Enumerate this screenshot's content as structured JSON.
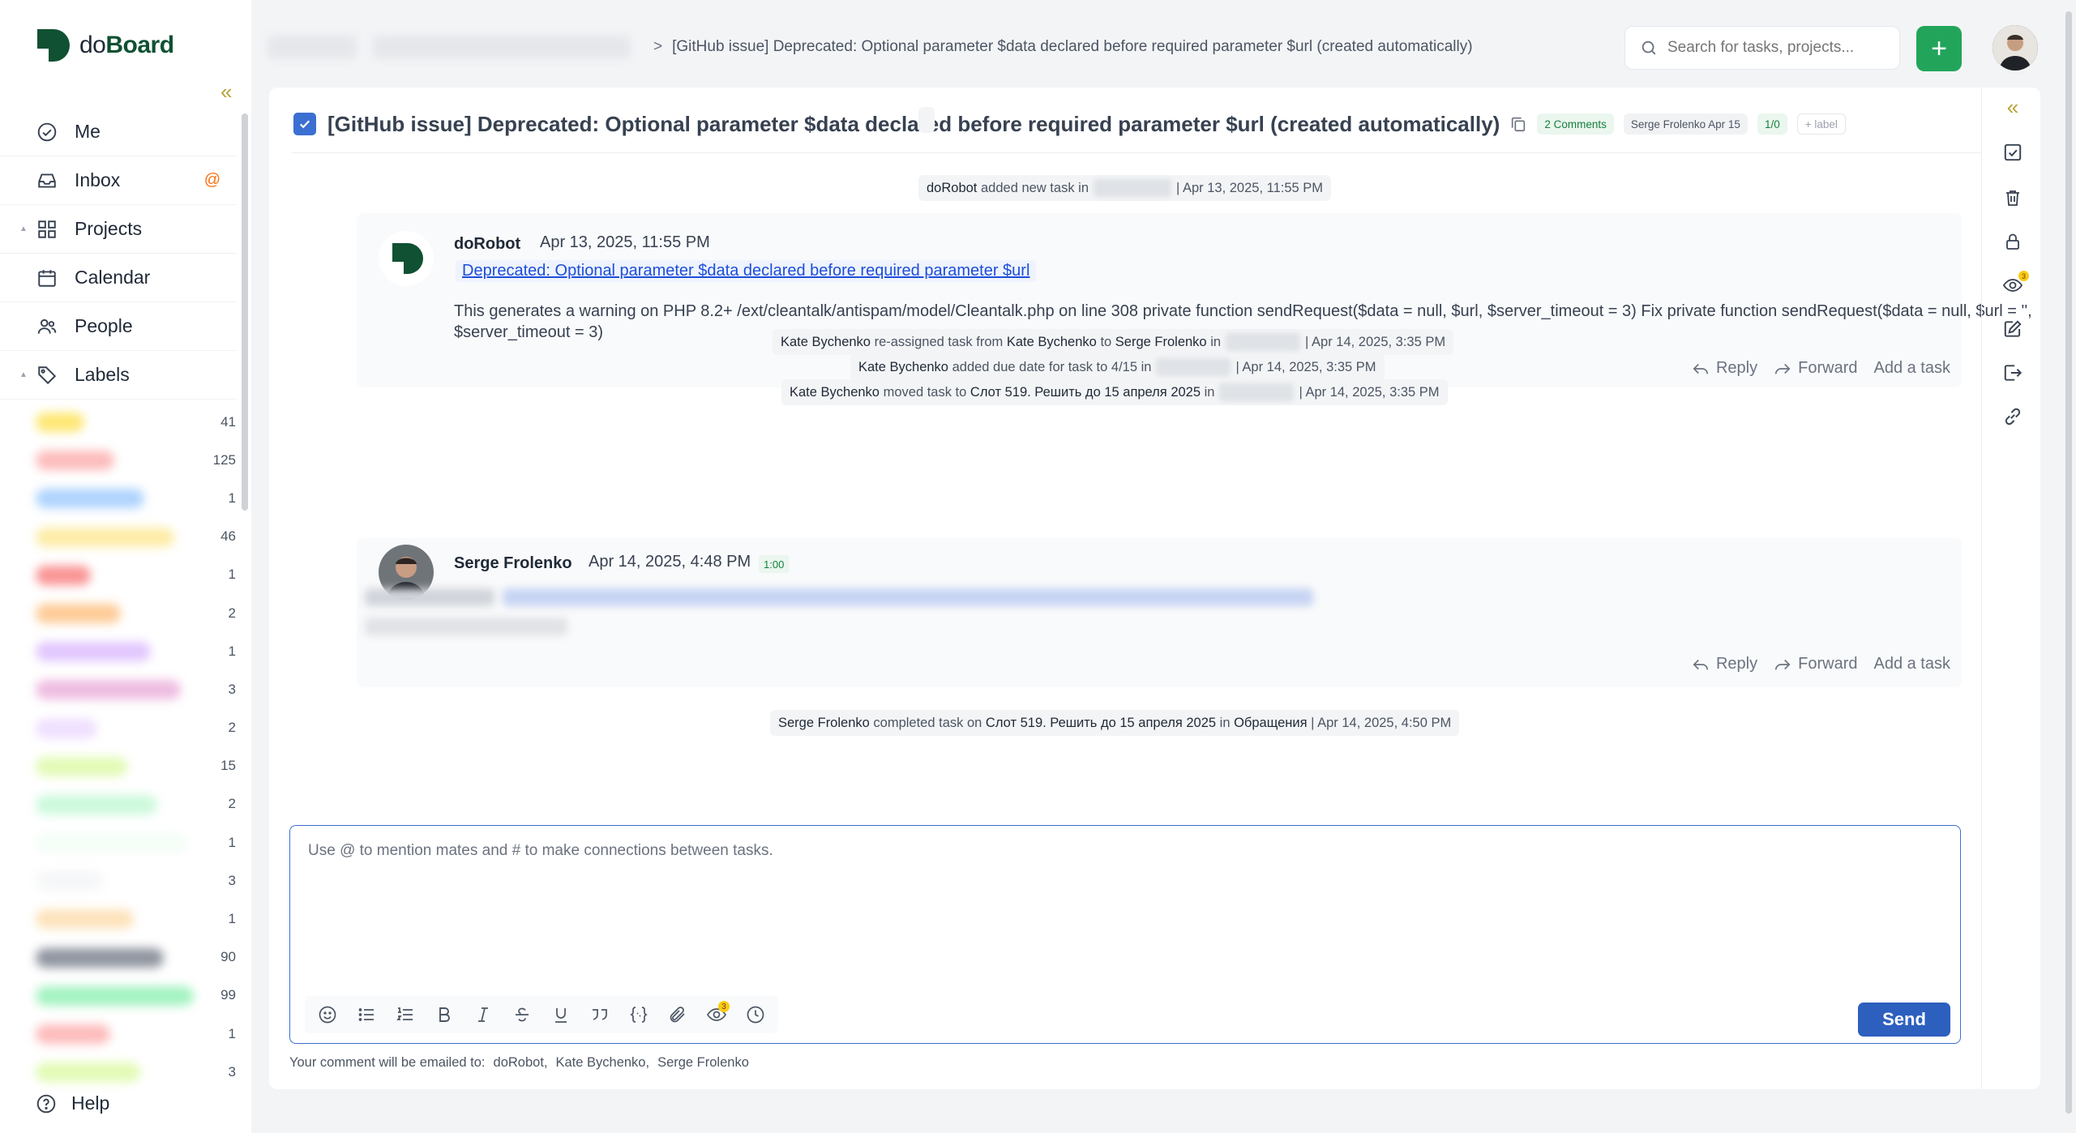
{
  "app": {
    "logo_text_do": "do",
    "logo_text_board": "Board"
  },
  "sidebar": {
    "collapse_icon": "double-chevron-left",
    "items": [
      {
        "label": "Me",
        "icon": "check-circle-icon"
      },
      {
        "label": "Inbox",
        "icon": "inbox-icon",
        "badge": "@"
      },
      {
        "label": "Projects",
        "icon": "grid-icon"
      },
      {
        "label": "Calendar",
        "icon": "calendar-icon"
      },
      {
        "label": "People",
        "icon": "people-icon"
      },
      {
        "label": "Labels",
        "icon": "tag-icon"
      }
    ],
    "labels": [
      {
        "count": "41",
        "color": "#fde047"
      },
      {
        "count": "125",
        "color": "#fca5a5"
      },
      {
        "count": "1",
        "color": "#93c5fd"
      },
      {
        "count": "46",
        "color": "#fde68a"
      },
      {
        "count": "1",
        "color": "#f87171"
      },
      {
        "count": "2",
        "color": "#fdba74"
      },
      {
        "count": "1",
        "color": "#d8b4fe"
      },
      {
        "count": "3",
        "color": "#e9a6d8"
      },
      {
        "count": "2",
        "color": "#e9d5ff"
      },
      {
        "count": "15",
        "color": "#d9f99d"
      },
      {
        "count": "2",
        "color": "#bbf7d0"
      },
      {
        "count": "1",
        "color": "#f0fdf4"
      },
      {
        "count": "3",
        "color": "#f3f4f6"
      },
      {
        "count": "1",
        "color": "#fcd9a5"
      },
      {
        "count": "90",
        "color": "#6b7280"
      },
      {
        "count": "99",
        "color": "#86efac"
      },
      {
        "count": "1",
        "color": "#fca5a5"
      },
      {
        "count": "3",
        "color": "#d9f99d"
      }
    ],
    "help_label": "Help"
  },
  "header": {
    "breadcrumb_separator": ">",
    "title": "[GitHub issue] Deprecated: Optional parameter $data declared before required parameter $url (created automatically)",
    "search_placeholder": "Search for tasks, projects...",
    "add_label": "+"
  },
  "task": {
    "title": "[GitHub issue] Deprecated: Optional parameter $data declared before required parameter $url (created automatically)",
    "chips": {
      "comments": "2 Comments",
      "assignee_due": "Serge Frolenko Apr 15",
      "checklist": "1/0",
      "label": "+ label"
    }
  },
  "activity": {
    "created": {
      "actor": "doRobot",
      "text_1": "added new task in",
      "text_2": "| Apr 13, 2025, 11:55 PM"
    },
    "reassigned": {
      "actor": "Kate Bychenko",
      "text_1": "re-assigned task from",
      "from": "Kate Bychenko",
      "text_2": "to",
      "to": "Serge Frolenko",
      "text_3": "in",
      "date": "| Apr 14, 2025, 3:35 PM"
    },
    "due": {
      "actor": "Kate Bychenko",
      "text_1": "added due date for task to 4/15 in",
      "date": "| Apr 14, 2025, 3:35 PM"
    },
    "moved": {
      "actor": "Kate Bychenko",
      "text_1": "moved task to",
      "target": "Слот 519. Решить до 15 апреля 2025",
      "text_2": "in",
      "date": "| Apr 14, 2025, 3:35 PM"
    },
    "completed": {
      "actor": "Serge Frolenko",
      "text_1": "completed task on",
      "target": "Слот 519. Решить до 15 апреля 2025",
      "text_2": "in",
      "project": "Обращения",
      "date": "| Apr 14, 2025, 4:50 PM"
    }
  },
  "comments": [
    {
      "author": "doRobot",
      "date": "Apr 13, 2025, 11:55 PM",
      "link": "Deprecated: Optional parameter $data declared before required parameter $url",
      "body": "This generates a warning on PHP 8.2+ /ext/cleantalk/antispam/model/Cleantalk.php on line 308 private function sendRequest($data = null, $url, $server_timeout = 3) Fix private function sendRequest($data = null, $url = '', $server_timeout = 3)"
    },
    {
      "author": "Serge Frolenko",
      "date": "Apr 14, 2025, 4:48 PM",
      "time_badge": "1:00"
    }
  ],
  "actions": {
    "reply": "Reply",
    "forward": "Forward",
    "add_task": "Add a task"
  },
  "composer": {
    "placeholder": "Use @ to mention mates and # to make connections between tasks.",
    "send_label": "Send",
    "watchers_count": "3",
    "email_note_prefix": "Your comment will be emailed to:",
    "recipients": [
      "doRobot,",
      "Kate Bychenko,",
      "Serge Frolenko"
    ]
  },
  "rail": {
    "watchers_count": "3"
  }
}
